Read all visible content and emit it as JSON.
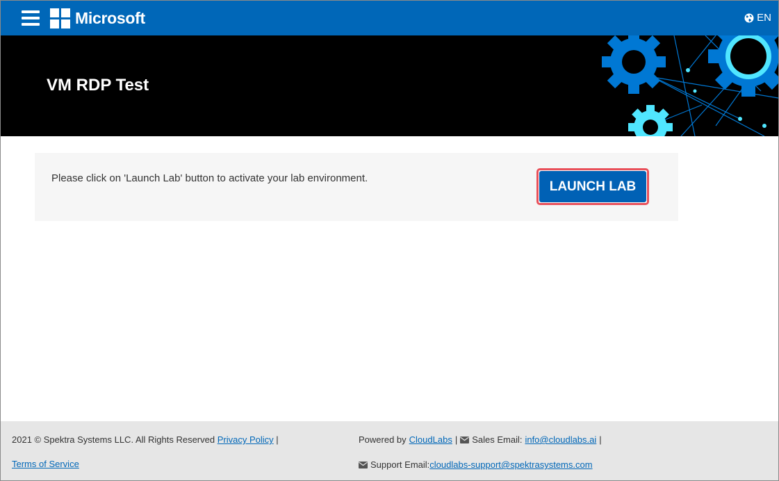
{
  "header": {
    "brand": "Microsoft",
    "language": "EN"
  },
  "banner": {
    "title": "VM RDP Test"
  },
  "launch_panel": {
    "message": "Please click on 'Launch Lab' button to activate your lab environment.",
    "button_label": "LAUNCH LAB"
  },
  "footer": {
    "copyright": "2021 © Spektra Systems LLC. All Rights Reserved",
    "privacy_link": "Privacy Policy",
    "separator": "|",
    "terms_link": "Terms of Service",
    "powered_by": "Powered by",
    "cloudlabs_link": "CloudLabs",
    "sales_label": "Sales Email:",
    "sales_email": "info@cloudlabs.ai",
    "support_label": "Support Email:",
    "support_email": "cloudlabs-support@spektrasystems.com"
  },
  "colors": {
    "topbar": "#0067b8",
    "banner": "#000000",
    "button": "#0061b5",
    "button_highlight": "#e9505a",
    "gear_blue": "#0078d4",
    "gear_cyan": "#50e6ff"
  }
}
